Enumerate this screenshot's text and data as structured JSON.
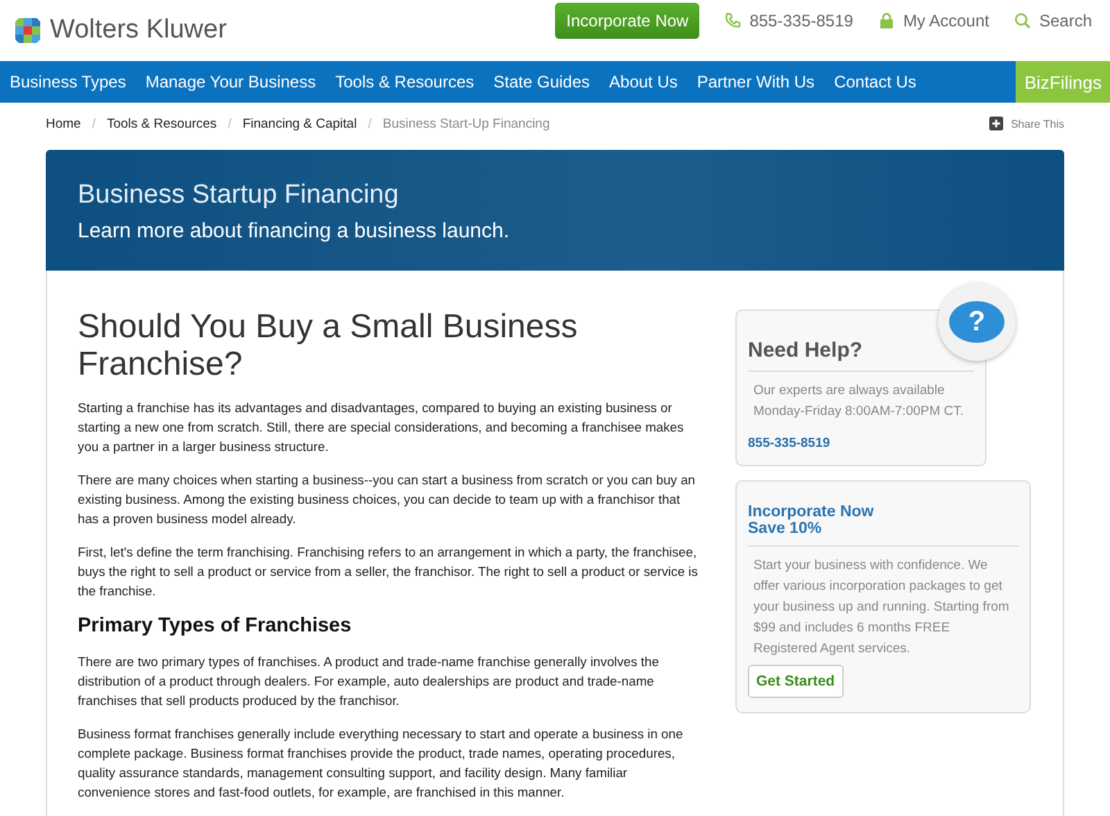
{
  "header": {
    "brand": "Wolters Kluwer",
    "cta": "Incorporate Now",
    "phone": "855-335-8519",
    "account": "My Account",
    "search": "Search"
  },
  "nav": {
    "items": [
      "Business Types",
      "Manage Your Business",
      "Tools & Resources",
      "State Guides",
      "About Us",
      "Partner With Us",
      "Contact Us"
    ],
    "badge": "BizFilings"
  },
  "breadcrumb": {
    "items": [
      "Home",
      "Tools & Resources",
      "Financing & Capital",
      "Business Start-Up Financing"
    ],
    "separator": "/",
    "share": "Share This"
  },
  "banner": {
    "title": "Business Startup Financing",
    "subtitle": "Learn more about financing a business launch."
  },
  "article": {
    "title": "Should You Buy a Small Business Franchise?",
    "blocks": [
      {
        "kind": "p",
        "text": "Starting a franchise has its advantages and disadvantages, compared to buying an existing business or starting a new one from scratch. Still, there are special considerations, and becoming a franchisee makes you a partner in a larger business structure."
      },
      {
        "kind": "p",
        "text": "There are many choices when starting a business--you can start a business from scratch or you can buy an existing business. Among the existing business choices, you can decide to team up with a franchisor that has a proven business model already."
      },
      {
        "kind": "p",
        "text": "First, let's define the term franchising. Franchising refers to an arrangement in which a party, the franchisee, buys the right to sell a product or service from a seller, the franchisor. The right to sell a product or service is the franchise."
      },
      {
        "kind": "h2",
        "text": "Primary Types of Franchises"
      },
      {
        "kind": "p",
        "text": "There are two primary types of franchises. A product and trade-name franchise generally involves the distribution of a product through dealers. For example, auto dealerships are product and trade-name franchises that sell products produced by the franchisor."
      },
      {
        "kind": "p",
        "text": "Business format franchises generally include everything necessary to start and operate a business in one complete package. Business format franchises provide the product, trade names, operating procedures, quality assurance standards, management consulting support, and facility design. Many familiar convenience stores and fast-food outlets, for example, are franchised in this manner."
      }
    ]
  },
  "help": {
    "title": "Need Help?",
    "text": "Our experts are always available Monday-Friday 8:00AM-7:00PM CT.",
    "phone": "855-335-8519",
    "icon": "?"
  },
  "promo": {
    "title": "Incorporate Now",
    "subtitle": "Save 10%",
    "text": "Start your business with confidence. We offer various incorporation packages to get your business up and running. Starting from $99 and includes 6 months FREE Registered Agent services.",
    "button": "Get Started"
  }
}
